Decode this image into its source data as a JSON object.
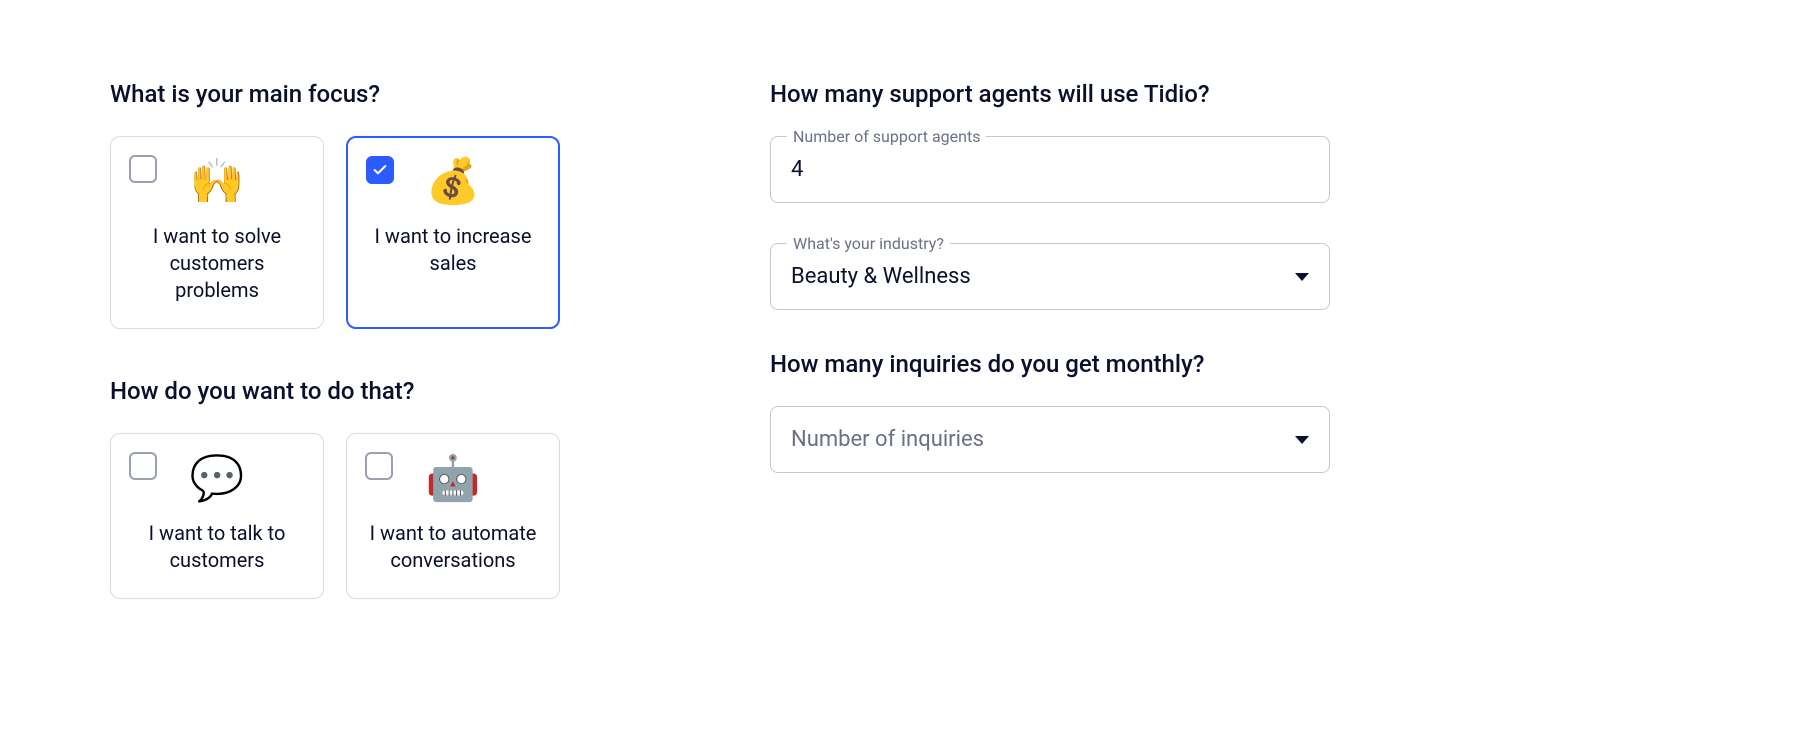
{
  "left": {
    "q1": "What is your main focus?",
    "focus": [
      {
        "emoji": "🙌",
        "label": "I want to solve customers problems",
        "checked": false
      },
      {
        "emoji": "💰",
        "label": "I want to increase sales",
        "checked": true
      }
    ],
    "q2": "How do you want to do that?",
    "method": [
      {
        "emoji": "💬",
        "label": "I want to talk to customers",
        "checked": false
      },
      {
        "emoji": "🤖",
        "label": "I want to automate conversations",
        "checked": false
      }
    ]
  },
  "right": {
    "q_agents": "How many support agents will use Tidio?",
    "agents_label": "Number of support agents",
    "agents_value": "4",
    "industry_label": "What's your industry?",
    "industry_value": "Beauty & Wellness",
    "q_inquiries": "How many inquiries do you get monthly?",
    "inquiries_placeholder": "Number of inquiries"
  }
}
